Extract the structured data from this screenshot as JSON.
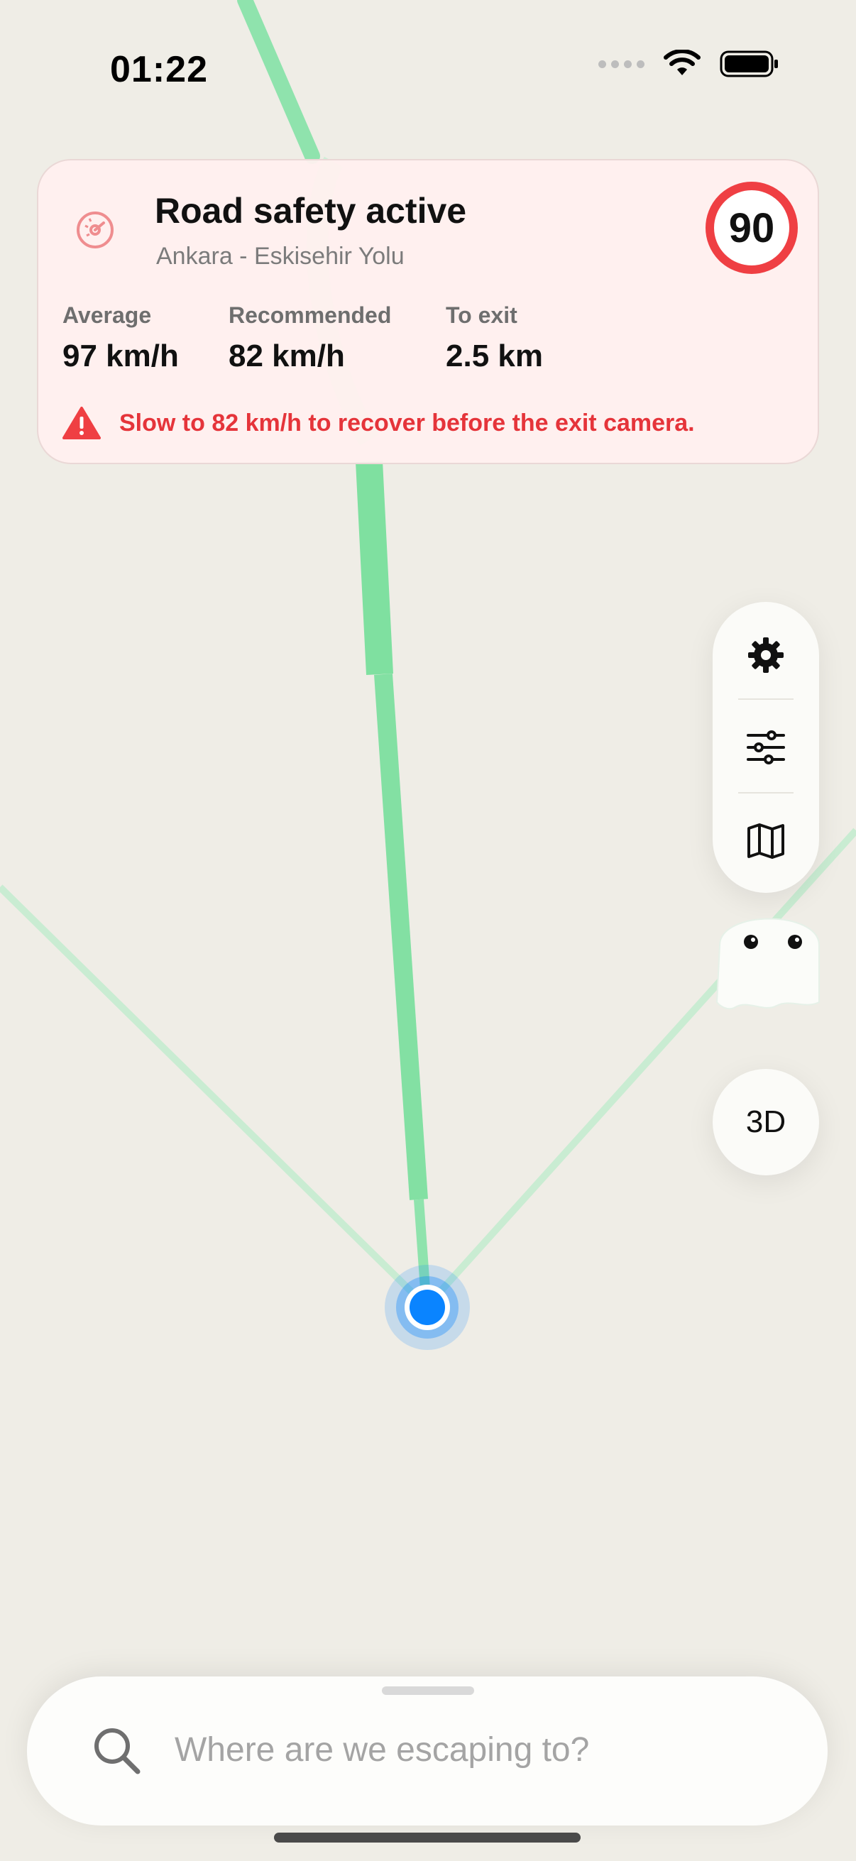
{
  "status_bar": {
    "time": "01:22",
    "icons": [
      "signal-dots-icon",
      "wifi-icon",
      "battery-icon"
    ]
  },
  "safety_card": {
    "icon": "speedometer-icon",
    "title": "Road safety active",
    "subtitle": "Ankara - Eskisehir Yolu",
    "speed_limit": "90",
    "stats": [
      {
        "label": "Average",
        "value": "97 km/h"
      },
      {
        "label": "Recommended",
        "value": "82 km/h"
      },
      {
        "label": "To exit",
        "value": "2.5 km"
      }
    ],
    "warning_icon": "warning-triangle-icon",
    "warning": "Slow to 82 km/h to recover before the exit camera."
  },
  "map_controls": {
    "items": [
      {
        "icon": "gear-icon"
      },
      {
        "icon": "sliders-icon"
      },
      {
        "icon": "map-icon"
      }
    ],
    "mascot_icon": "ghost-icon",
    "view_toggle": "3D"
  },
  "search": {
    "placeholder": "Where are we escaping to?",
    "value": "",
    "icon": "search-icon"
  },
  "colors": {
    "route": "#7fe0a0",
    "location": "#0a84ff",
    "alert": "#e5343a",
    "speed_ring": "#ef3f43"
  }
}
